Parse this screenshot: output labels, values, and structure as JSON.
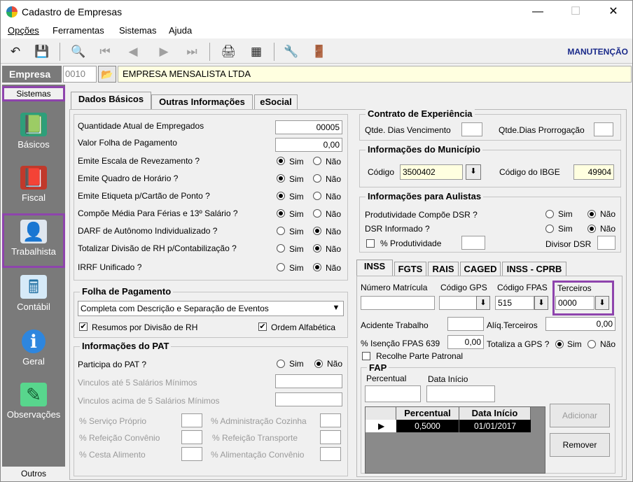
{
  "window": {
    "title": "Cadastro de Empresas"
  },
  "menu": [
    "Opções",
    "Ferramentas",
    "Sistemas",
    "Ajuda"
  ],
  "toolbar": {
    "mode": "MANUTENÇÃO"
  },
  "empresa": {
    "label": "Empresa",
    "code": "0010",
    "name": "EMPRESA MENSALISTA LTDA"
  },
  "sidebar": {
    "header": "Sistemas",
    "footer": "Outros",
    "items": [
      "Básicos",
      "Fiscal",
      "Trabalhista",
      "Contábil",
      "Geral",
      "Observações"
    ]
  },
  "tabs": [
    "Dados Básicos",
    "Outras Informações",
    "eSocial"
  ],
  "left": {
    "rows": [
      {
        "label": "Quantidade Atual de Empregados",
        "value": "00005"
      },
      {
        "label": "Valor Folha de Pagamento",
        "value": "0,00"
      }
    ],
    "yes": "Sim",
    "no": "Não",
    "questions": [
      {
        "label": "Emite Escala de Revezamento ?",
        "sel": "sim"
      },
      {
        "label": "Emite Quadro de Horário ?",
        "sel": "sim"
      },
      {
        "label": "Emite Etiqueta p/Cartão de Ponto ?",
        "sel": "sim"
      },
      {
        "label": "Compõe Média Para Férias e 13º Salário ?",
        "sel": "sim"
      },
      {
        "label": "DARF de Autônomo Individualizado ?",
        "sel": "nao"
      },
      {
        "label": "Totalizar Divisão de RH p/Contabilização ?",
        "sel": "nao"
      },
      {
        "label": "IRRF Unificado ?",
        "sel": "nao"
      }
    ]
  },
  "folha": {
    "title": "Folha de Pagamento",
    "select": "Completa com Descrição e Separação de Eventos",
    "chk1": "Resumos por Divisão de RH",
    "chk2": "Ordem Alfabética"
  },
  "pat": {
    "title": "Informações do PAT",
    "participa": "Participa do PAT ?",
    "ate5": "Vinculos até 5 Salários Mínimos",
    "acima5": "Vinculos acima de 5 Salários Mínimos",
    "servico": "% Serviço Próprio",
    "adm": "% Administração Cozinha",
    "refconv": "% Refeição Convênio",
    "reftransp": "% Refeição Transporte",
    "cesta": "% Cesta Alimento",
    "alimconv": "% Alimentação Convênio"
  },
  "contrato": {
    "title": "Contrato de Experiência",
    "venc": "Qtde. Dias Vencimento",
    "prorrog": "Qtde.Dias Prorrogação"
  },
  "municipio": {
    "title": "Informações do Município",
    "codigo_label": "Código",
    "codigo": "3500402",
    "ibge_label": "Código do IBGE",
    "ibge": "49904"
  },
  "aulistas": {
    "title": "Informações para Aulistas",
    "prod": "Produtividade Compõe DSR ?",
    "dsr": "DSR Informado ?",
    "pct": "% Produtividade",
    "divisor": "Divisor DSR"
  },
  "tabs2": [
    "INSS",
    "FGTS",
    "RAIS",
    "CAGED",
    "INSS - CPRB"
  ],
  "inss": {
    "matricula": "Número Matrícula",
    "gps": "Código GPS",
    "fpas_label": "Código FPAS",
    "fpas": "515",
    "terceiros_label": "Terceiros",
    "terceiros": "0000",
    "acidente": "Acidente Trabalho",
    "aliq": "Alíq.Terceiros",
    "aliq_val": "0,00",
    "isencao": "% Isenção FPAS 639",
    "isencao_val": "0,00",
    "totaliza": "Totaliza a GPS ?",
    "recolhe": "Recolhe Parte Patronal"
  },
  "fap": {
    "title": "FAP",
    "percentual": "Percentual",
    "data": "Data Início",
    "col1": "Percentual",
    "col2": "Data Início",
    "row_pct": "0,5000",
    "row_data": "01/01/2017",
    "add": "Adicionar",
    "remove": "Remover"
  }
}
